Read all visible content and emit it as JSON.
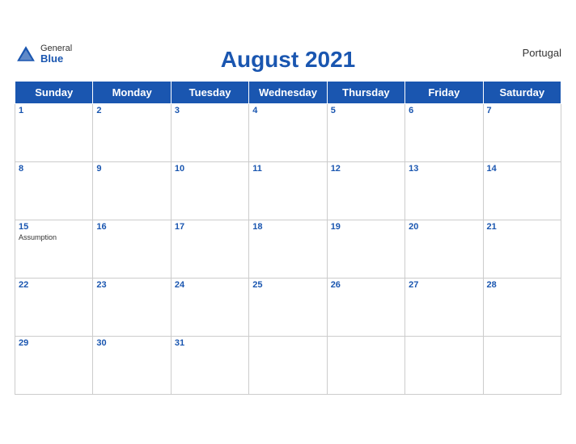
{
  "header": {
    "title": "August 2021",
    "country": "Portugal",
    "logo": {
      "general": "General",
      "blue": "Blue"
    }
  },
  "weekdays": [
    "Sunday",
    "Monday",
    "Tuesday",
    "Wednesday",
    "Thursday",
    "Friday",
    "Saturday"
  ],
  "weeks": [
    [
      {
        "day": "1",
        "events": []
      },
      {
        "day": "2",
        "events": []
      },
      {
        "day": "3",
        "events": []
      },
      {
        "day": "4",
        "events": []
      },
      {
        "day": "5",
        "events": []
      },
      {
        "day": "6",
        "events": []
      },
      {
        "day": "7",
        "events": []
      }
    ],
    [
      {
        "day": "8",
        "events": []
      },
      {
        "day": "9",
        "events": []
      },
      {
        "day": "10",
        "events": []
      },
      {
        "day": "11",
        "events": []
      },
      {
        "day": "12",
        "events": []
      },
      {
        "day": "13",
        "events": []
      },
      {
        "day": "14",
        "events": []
      }
    ],
    [
      {
        "day": "15",
        "events": [
          "Assumption"
        ]
      },
      {
        "day": "16",
        "events": []
      },
      {
        "day": "17",
        "events": []
      },
      {
        "day": "18",
        "events": []
      },
      {
        "day": "19",
        "events": []
      },
      {
        "day": "20",
        "events": []
      },
      {
        "day": "21",
        "events": []
      }
    ],
    [
      {
        "day": "22",
        "events": []
      },
      {
        "day": "23",
        "events": []
      },
      {
        "day": "24",
        "events": []
      },
      {
        "day": "25",
        "events": []
      },
      {
        "day": "26",
        "events": []
      },
      {
        "day": "27",
        "events": []
      },
      {
        "day": "28",
        "events": []
      }
    ],
    [
      {
        "day": "29",
        "events": []
      },
      {
        "day": "30",
        "events": []
      },
      {
        "day": "31",
        "events": []
      },
      {
        "day": "",
        "events": []
      },
      {
        "day": "",
        "events": []
      },
      {
        "day": "",
        "events": []
      },
      {
        "day": "",
        "events": []
      }
    ]
  ],
  "colors": {
    "header_bg": "#1a56b0",
    "header_text": "#ffffff",
    "day_number": "#1a56b0",
    "border": "#cccccc"
  }
}
